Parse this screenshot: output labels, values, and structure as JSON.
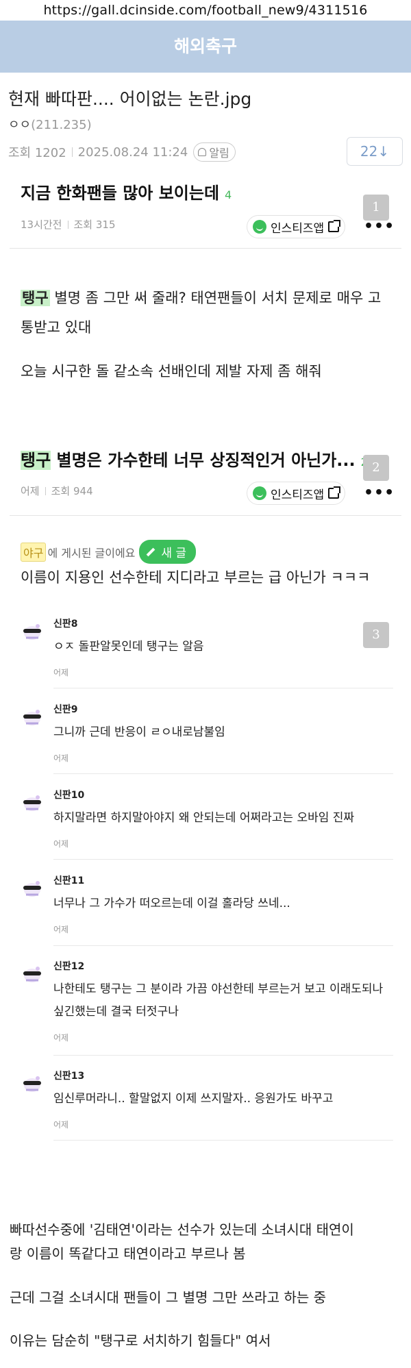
{
  "browser": {
    "url": "https://gall.dcinside.com/football_new9/4311516"
  },
  "gallery": {
    "name": "해외축구"
  },
  "post": {
    "title": "현재 빠따판.... 어이없는 논란.jpg",
    "writer": "ㅇㅇ",
    "ip": "(211.235)",
    "views": "조회 1202",
    "date": "2025.08.24 11:24",
    "alarm_label": "알림",
    "comment_count": "22↓"
  },
  "cards": [
    {
      "title": "지금 한화팬들 많아 보이는데",
      "count": "4",
      "time": "13시간전",
      "views": "조회 315",
      "app": "인스티즈앱",
      "badge": "1",
      "more": "•••"
    },
    {
      "title_hl": "탱구",
      "title": " 별명은 가수한테 너무 상징적인거 아닌가...",
      "count": "25",
      "time": "어제",
      "views": "조회 944",
      "app": "인스티즈앱",
      "badge": "2",
      "more": "•••"
    }
  ],
  "card1_body": {
    "tag": "탱구",
    "line1": " 별명 좀 그만 써 줄래? 태연팬들이 서치 문제로 매우 고",
    "line2": "통받고 있대",
    "line3": "오늘 시구한 돌 같소속 선배인데 제발 자제 좀 해줘"
  },
  "card2_body": {
    "board_tag": "야구",
    "board_suffix": "에 게시된 글이에요",
    "new_label": "새 글",
    "line1": "이름이 지용인 선수한테 지디라고 부르는 급 아닌가 ㅋㅋㅋ"
  },
  "comments_badge": "3",
  "comments": [
    {
      "nick": "신판8",
      "text": "ㅇㅈ 돌판알못인데 탱구는 알음",
      "date": "어제"
    },
    {
      "nick": "신판9",
      "text": "그니까 근데 반응이 ㄹㅇ내로남불임",
      "date": "어제"
    },
    {
      "nick": "신판10",
      "text": "하지말라면 하지말아야지 왜 안되는데 어쩌라고는 오바임 진짜",
      "date": "어제"
    },
    {
      "nick": "신판11",
      "text": "너무나 그 가수가 떠오르는데 이걸 홀라당 쓰네...",
      "date": "어제"
    },
    {
      "nick": "신판12",
      "text": "나한테도 탱구는 그 분이라 가끔 야선한테 부르는거 보고 이래도되나 싶긴했는데 결국 터젓구나",
      "date": "어제"
    },
    {
      "nick": "신판13",
      "text": "임신루머라니.. 할말없지 이제 쓰지말자.. 응원가도 바꾸고",
      "date": "어제"
    }
  ],
  "summary": {
    "line1": "빠따선수중에 '김태연'이라는 선수가 있는데 소녀시대 태연이",
    "line2": "랑 이름이 똑같다고 태연이라고 부르나 봄",
    "line3": "근데 그걸 소녀시대 팬들이 그 별명 그만 쓰라고 하는 중",
    "line4": "이유는 담순히 \"탱구로 서치하기 힘들다\" 여서"
  }
}
